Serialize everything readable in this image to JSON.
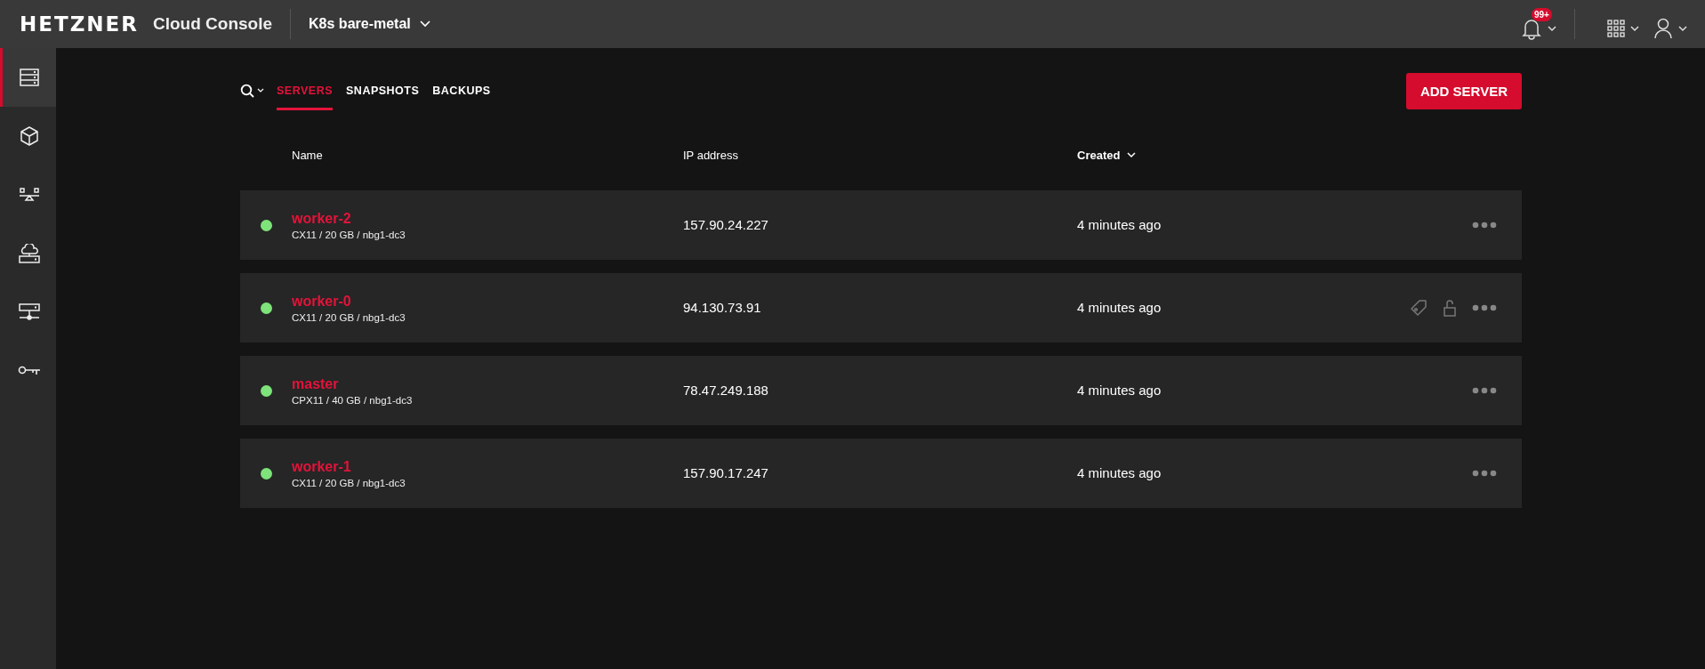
{
  "header": {
    "logo": "HETZNER",
    "product": "Cloud Console",
    "project": "K8s bare-metal",
    "notification_badge": "99+"
  },
  "sidebar": {
    "items": [
      {
        "kind": "servers",
        "selected": true
      },
      {
        "kind": "volumes",
        "selected": false
      },
      {
        "kind": "loadbalancer",
        "selected": false
      },
      {
        "kind": "cloudnet",
        "selected": false
      },
      {
        "kind": "network",
        "selected": false
      },
      {
        "kind": "keys",
        "selected": false
      }
    ]
  },
  "tabs": [
    {
      "label": "SERVERS",
      "selected": true
    },
    {
      "label": "SNAPSHOTS",
      "selected": false
    },
    {
      "label": "BACKUPS",
      "selected": false
    }
  ],
  "add_button": "ADD SERVER",
  "table": {
    "columns": [
      "Name",
      "IP address",
      "Created"
    ],
    "rows": [
      {
        "name": "worker-2",
        "spec": "CX11 / 20 GB / nbg1-dc3",
        "ip": "157.90.24.227",
        "created": "4 minutes ago",
        "running": true,
        "hovered": false
      },
      {
        "name": "worker-0",
        "spec": "CX11 / 20 GB / nbg1-dc3",
        "ip": "94.130.73.91",
        "created": "4 minutes ago",
        "running": true,
        "hovered": true
      },
      {
        "name": "master",
        "spec": "CPX11 / 40 GB / nbg1-dc3",
        "ip": "78.47.249.188",
        "created": "4 minutes ago",
        "running": true,
        "hovered": false
      },
      {
        "name": "worker-1",
        "spec": "CX11 / 20 GB / nbg1-dc3",
        "ip": "157.90.17.247",
        "created": "4 minutes ago",
        "running": true,
        "hovered": false
      }
    ]
  }
}
